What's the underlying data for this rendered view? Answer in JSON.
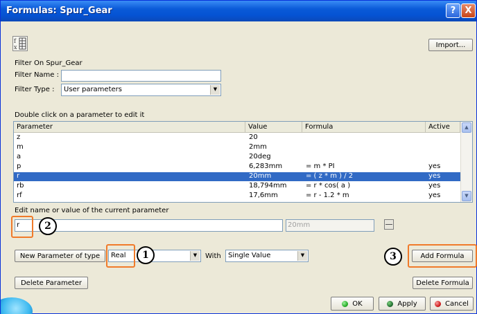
{
  "window": {
    "title": "Formulas: Spur_Gear",
    "help_glyph": "?",
    "close_glyph": "X"
  },
  "toolbar": {
    "import_label": "Import...",
    "formula_icon": "formula-table-icon"
  },
  "filter": {
    "heading": "Filter On Spur_Gear",
    "name_label": "Filter Name :",
    "name_value": "",
    "type_label": "Filter Type :",
    "type_value": "User parameters"
  },
  "list": {
    "instruction": "Double click on a parameter to edit it",
    "columns": [
      "Parameter",
      "Value",
      "Formula",
      "Active"
    ],
    "rows": [
      {
        "parameter": "z",
        "value": "20",
        "formula": "",
        "active": ""
      },
      {
        "parameter": "m",
        "value": "2mm",
        "formula": "",
        "active": ""
      },
      {
        "parameter": "a",
        "value": "20deg",
        "formula": "",
        "active": ""
      },
      {
        "parameter": "p",
        "value": "6,283mm",
        "formula": "= m * PI",
        "active": "yes"
      },
      {
        "parameter": "r",
        "value": "20mm",
        "formula": "= ( z * m ) / 2",
        "active": "yes",
        "selected": true
      },
      {
        "parameter": "rb",
        "value": "18,794mm",
        "formula": "= r * cos( a )",
        "active": "yes"
      },
      {
        "parameter": "rf",
        "value": "17,6mm",
        "formula": "= r - 1.2 * m",
        "active": "yes"
      }
    ]
  },
  "edit": {
    "label": "Edit name or value of the current parameter",
    "name_value": "r",
    "value_value": "20mm"
  },
  "new_param": {
    "button_label": "New Parameter of type",
    "type_value": "Real",
    "with_label": "With",
    "with_value": "Single Value"
  },
  "buttons": {
    "add_formula": "Add Formula",
    "delete_parameter": "Delete Parameter",
    "delete_formula": "Delete Formula",
    "ok": "OK",
    "apply": "Apply",
    "cancel": "Cancel"
  },
  "callouts": {
    "one": "1",
    "two": "2",
    "three": "3"
  },
  "colors": {
    "title_bar": "#0553d3",
    "selection": "#316ac5",
    "highlight": "#f07a2a",
    "ok": "#2bb02b",
    "apply": "#1f6b2f",
    "cancel": "#d22020"
  }
}
